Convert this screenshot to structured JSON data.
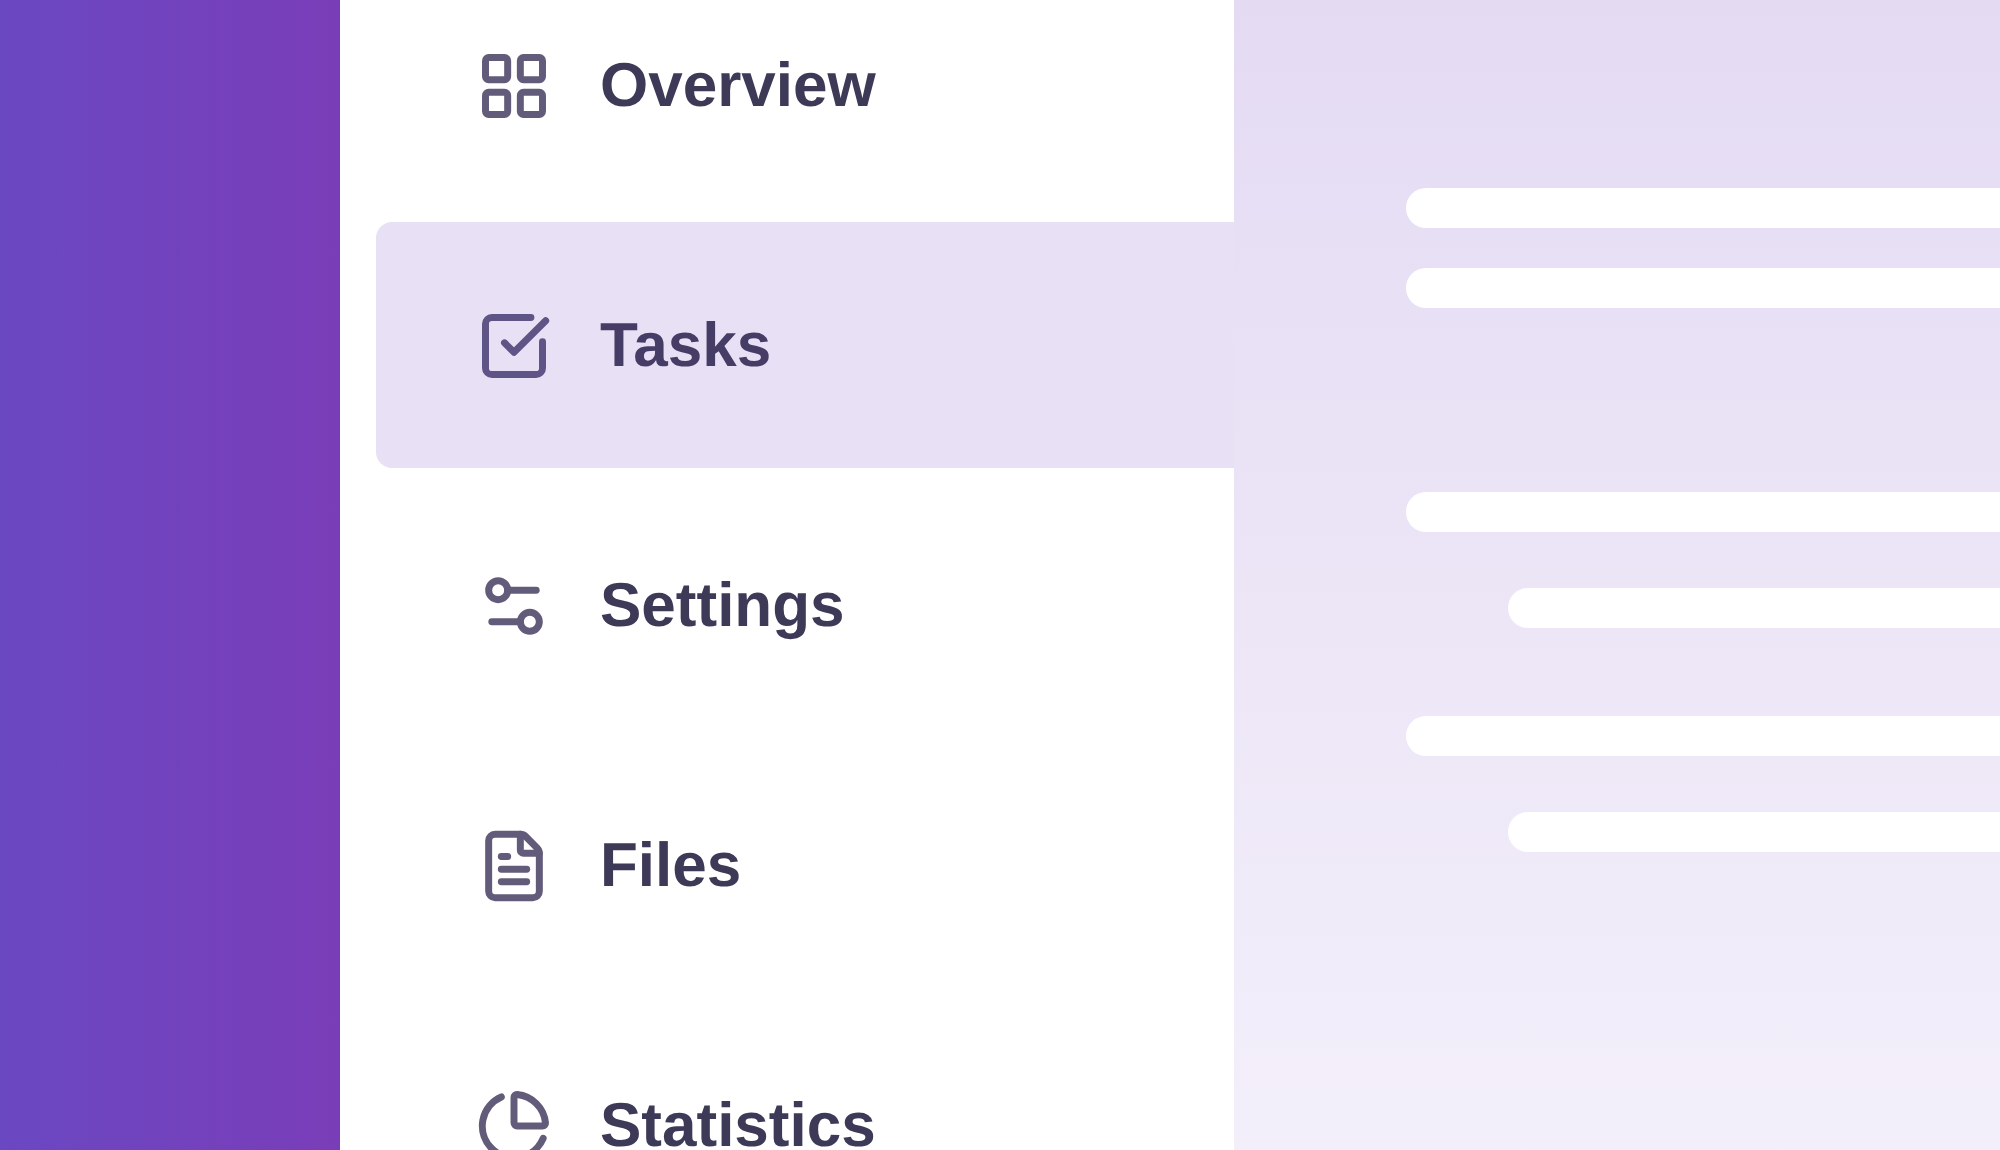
{
  "sidebar": {
    "items": [
      {
        "label": "Overview",
        "selected": false
      },
      {
        "label": "Tasks",
        "selected": true
      },
      {
        "label": "Settings",
        "selected": false
      },
      {
        "label": "Files",
        "selected": false
      },
      {
        "label": "Statistics",
        "selected": false
      }
    ]
  }
}
